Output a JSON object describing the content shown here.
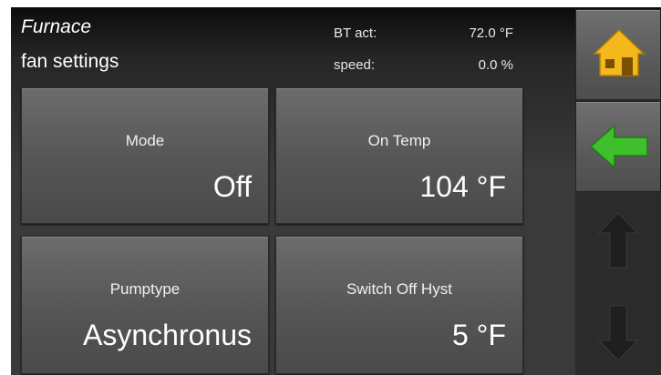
{
  "header": {
    "title_line1": "Furnace",
    "title_line2": "fan settings",
    "stats": [
      {
        "label": "BT act:",
        "value": "72.0 °F"
      },
      {
        "label": "speed:",
        "value": "0.0 %"
      }
    ]
  },
  "tiles": [
    {
      "label": "Mode",
      "value": "Off"
    },
    {
      "label": "On Temp",
      "value": "104 °F"
    },
    {
      "label": "Pumptype",
      "value": "Asynchronus"
    },
    {
      "label": "Switch Off Hyst",
      "value": "5 °F"
    }
  ],
  "nav": {
    "home_icon": "home-icon",
    "back_icon": "back-arrow-icon",
    "up_icon": "scroll-up-arrow-icon",
    "down_icon": "scroll-down-arrow-icon",
    "colors": {
      "home": "#f5b81c",
      "back": "#3fbf2c",
      "disabled": "#1e1e1e"
    }
  }
}
